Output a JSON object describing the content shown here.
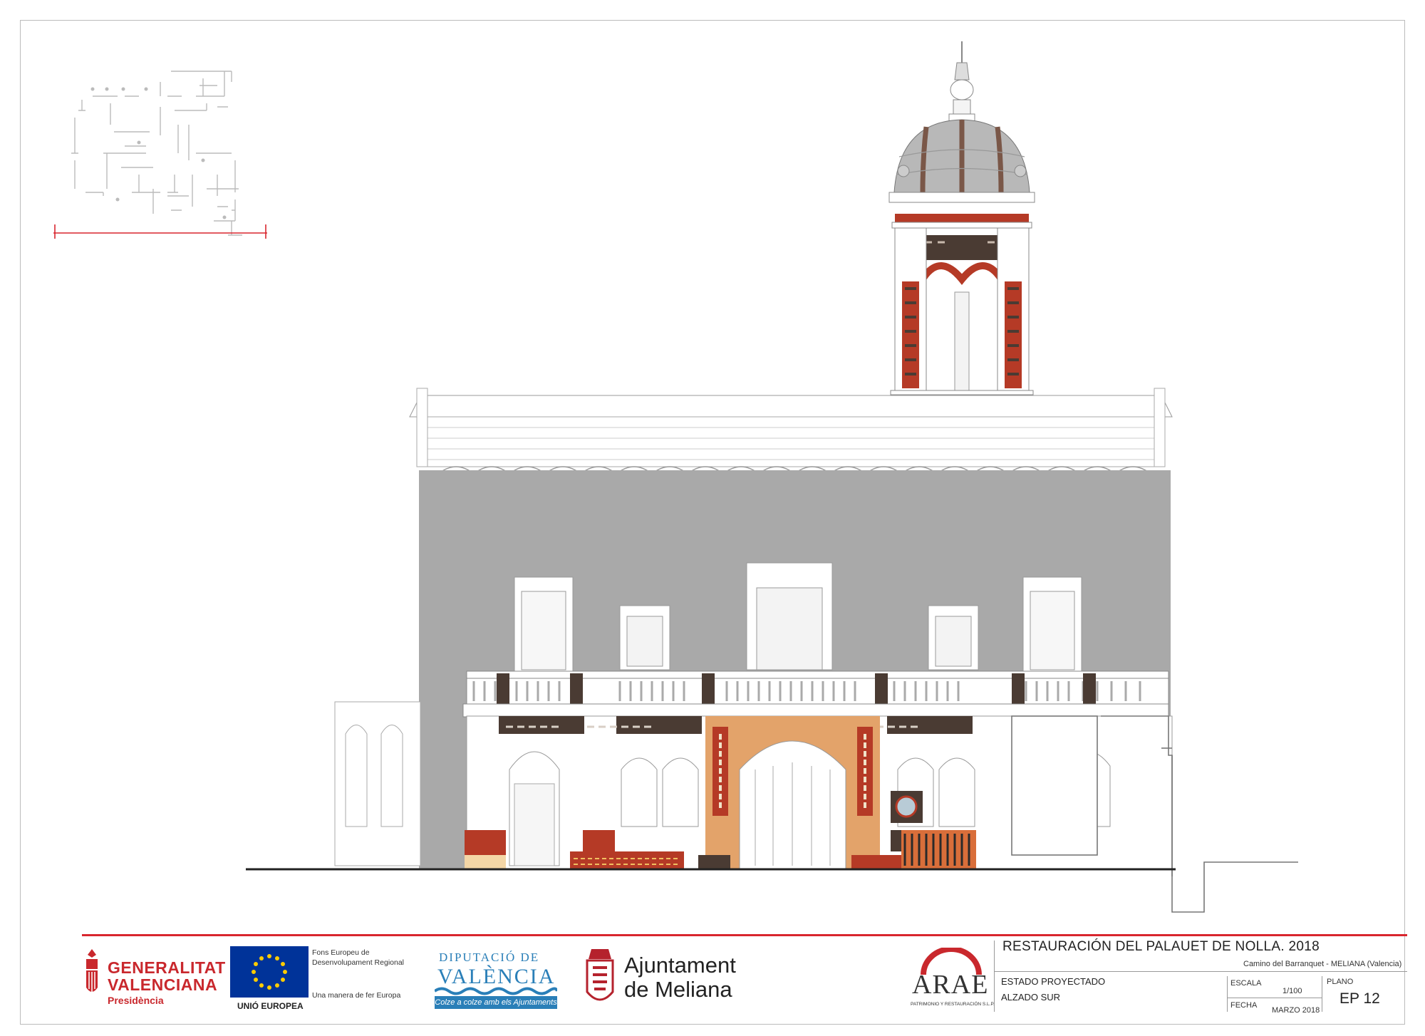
{
  "sheet": {
    "project_title": "RESTAURACIÓN DEL PALAUET DE NOLLA. 2018",
    "location": "Camino del Barranquet - MELIANA (Valencia)",
    "state": "ESTADO PROYECTADO",
    "view": "ALZADO SUR",
    "scale_label": "ESCALA",
    "scale_value": "1/100",
    "date_label": "FECHA",
    "date_value": "MARZO 2018",
    "plan_label": "PLANO",
    "plan_value": "EP 12"
  },
  "logos": {
    "generalitat": {
      "line1": "GENERALITAT",
      "line2": "VALENCIANA",
      "sub": "Presidència",
      "color": "#c9282d"
    },
    "eu": {
      "fund_line1": "Fons Europeu de",
      "fund_line2": "Desenvolupament Regional",
      "motto": "Una manera de fer Europa",
      "label": "UNIÓ EUROPEA",
      "flag_color": "#003399",
      "star_color": "#ffcc00"
    },
    "diputacio": {
      "line1": "DIPUTACIÓ DE",
      "line2": "VALÈNCIA",
      "tagline": "Colze a colze amb els Ajuntaments",
      "color": "#2a7fb8"
    },
    "ajuntament": {
      "line1": "Ajuntament",
      "line2": "de Meliana",
      "color": "#b5222d"
    },
    "arae": {
      "name": "ARAE",
      "sub": "PATRIMONIO Y RESTAURACIÓN S.L.P.",
      "color": "#c9282d"
    }
  },
  "colors": {
    "accent_red": "#d8262e",
    "wall_grey": "#a9a9a9",
    "ochre": "#e3a36a",
    "tile_red": "#b53a26",
    "tile_dark": "#4a3b33"
  }
}
